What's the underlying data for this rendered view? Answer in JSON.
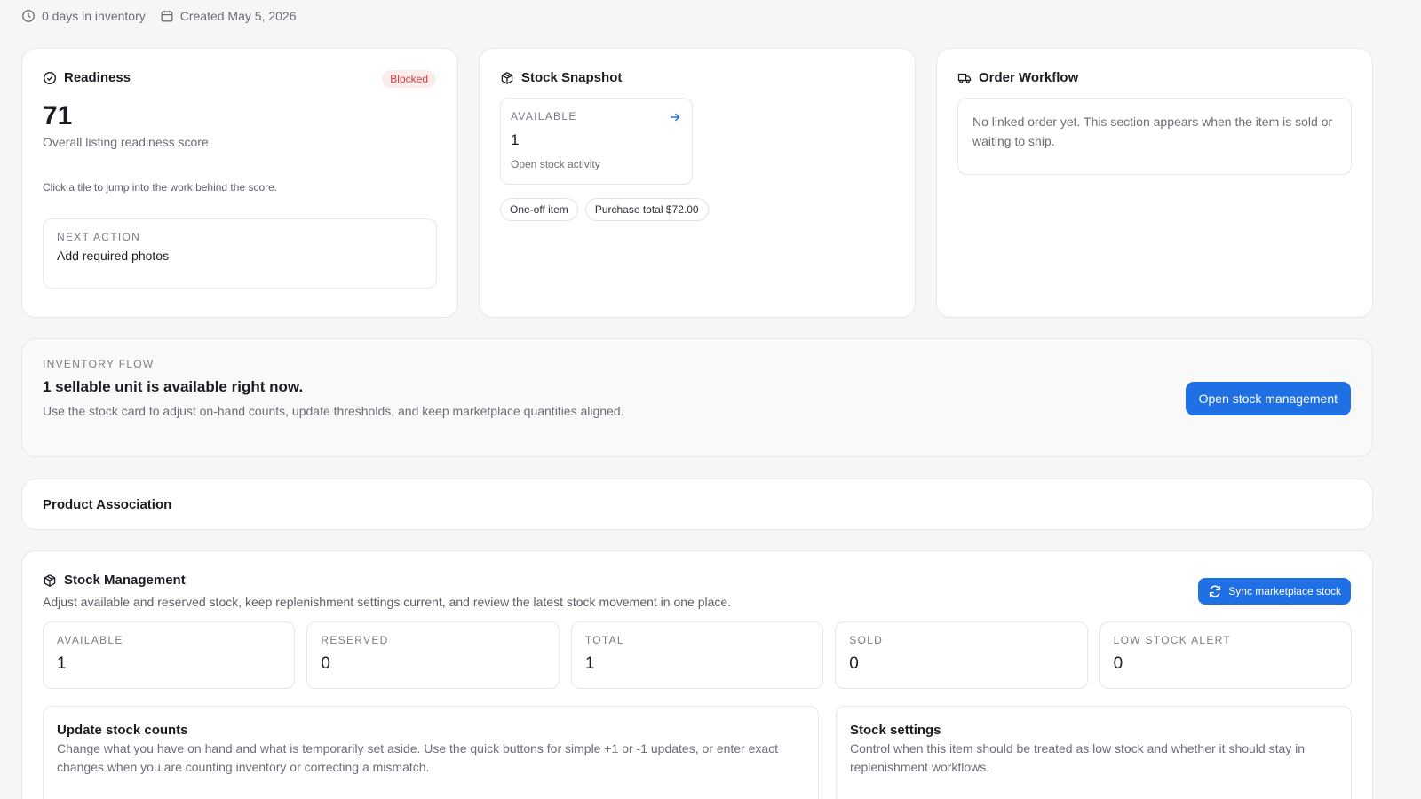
{
  "meta": {
    "days_in_inventory": "0 days in inventory",
    "created": "Created May 5, 2026"
  },
  "readiness": {
    "title": "Readiness",
    "badge": "Blocked",
    "score": "71",
    "score_label": "Overall listing readiness score",
    "hint": "Click a tile to jump into the work behind the score.",
    "next_action_label": "NEXT ACTION",
    "next_action_value": "Add required photos"
  },
  "snapshot": {
    "title": "Stock Snapshot",
    "tile_label": "AVAILABLE",
    "tile_value": "1",
    "tile_link": "Open stock activity",
    "chips": [
      "One-off item",
      "Purchase total $72.00"
    ]
  },
  "order": {
    "title": "Order Workflow",
    "empty_text": "No linked order yet. This section appears when the item is sold or waiting to ship."
  },
  "flow": {
    "eyebrow": "INVENTORY FLOW",
    "headline": "1 sellable unit is available right now.",
    "description": "Use the stock card to adjust on-hand counts, update thresholds, and keep marketplace quantities aligned.",
    "button": "Open stock management"
  },
  "association": {
    "title": "Product Association"
  },
  "stock": {
    "title": "Stock Management",
    "description": "Adjust available and reserved stock, keep replenishment settings current, and review the latest stock movement in one place.",
    "sync_button": "Sync marketplace stock",
    "stats": [
      {
        "label": "AVAILABLE",
        "value": "1"
      },
      {
        "label": "RESERVED",
        "value": "0"
      },
      {
        "label": "TOTAL",
        "value": "1"
      },
      {
        "label": "SOLD",
        "value": "0"
      },
      {
        "label": "LOW STOCK ALERT",
        "value": "0"
      }
    ],
    "update_title": "Update stock counts",
    "update_desc": "Change what you have on hand and what is temporarily set aside. Use the quick buttons for simple +1 or -1 updates, or enter exact changes when you are counting inventory or correcting a mismatch.",
    "settings_title": "Stock settings",
    "settings_desc": "Control when this item should be treated as low stock and whether it should stay in replenishment workflows."
  },
  "colors": {
    "accent": "#1f6fe5",
    "blocked_bg": "#fdecec",
    "blocked_text": "#d23c3c",
    "page_bg": "#f6f6f7"
  },
  "icons": {
    "clock": "clock-icon",
    "calendar": "calendar-icon",
    "check_circle": "check-circle-icon",
    "box": "box-icon",
    "truck": "truck-icon",
    "arrow_right": "arrow-right-icon",
    "refresh": "refresh-icon"
  }
}
